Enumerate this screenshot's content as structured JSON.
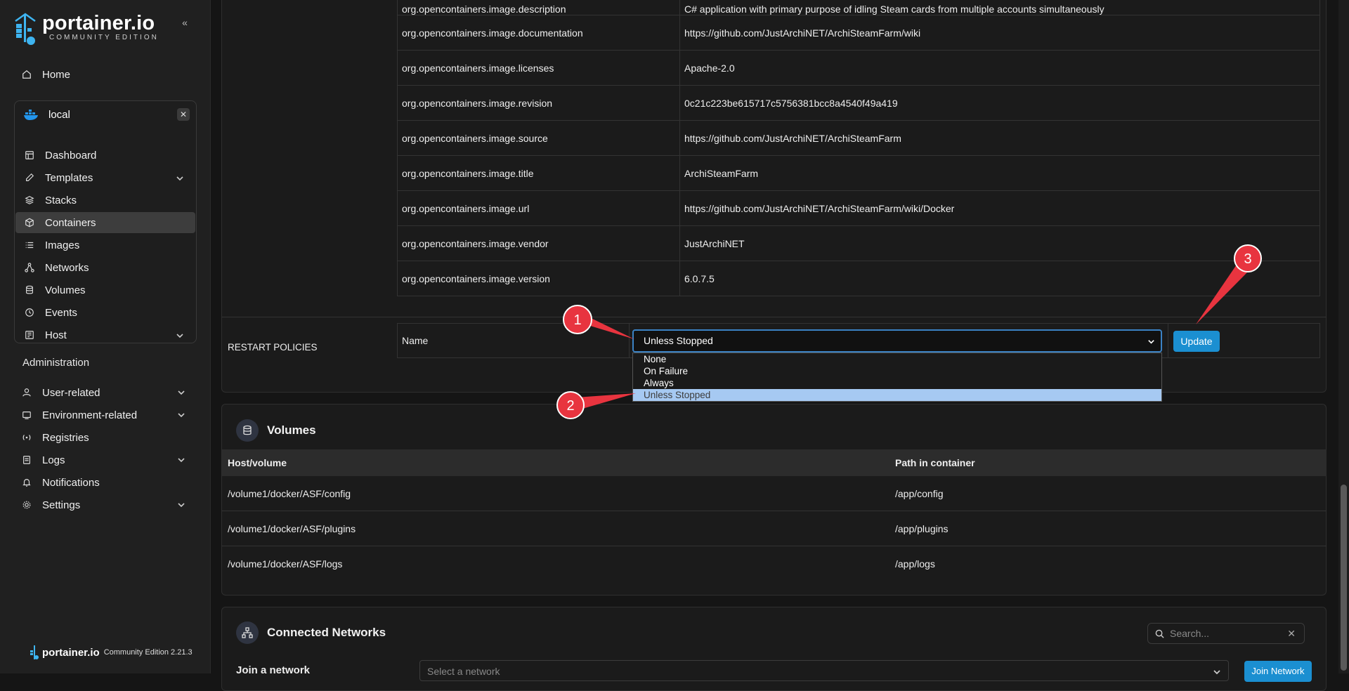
{
  "sidebar": {
    "logo_main": "portainer.io",
    "logo_sub": "COMMUNITY EDITION",
    "home": "Home",
    "environment": {
      "name": "local",
      "close": "✕",
      "items": [
        {
          "label": "Dashboard",
          "icon": "dashboard-icon"
        },
        {
          "label": "Templates",
          "icon": "edit-icon"
        },
        {
          "label": "Stacks",
          "icon": "layers-icon"
        },
        {
          "label": "Containers",
          "icon": "box-icon"
        },
        {
          "label": "Images",
          "icon": "list-icon"
        },
        {
          "label": "Networks",
          "icon": "network-icon"
        },
        {
          "label": "Volumes",
          "icon": "database-icon"
        },
        {
          "label": "Events",
          "icon": "clock-icon"
        },
        {
          "label": "Host",
          "icon": "server-icon"
        }
      ],
      "active": "Containers"
    },
    "admin_title": "Administration",
    "admin_items": [
      {
        "label": "User-related"
      },
      {
        "label": "Environment-related"
      },
      {
        "label": "Registries"
      },
      {
        "label": "Logs"
      },
      {
        "label": "Notifications"
      },
      {
        "label": "Settings"
      }
    ],
    "footer_brand": "portainer.io",
    "footer_version": "Community Edition 2.21.3"
  },
  "labels": [
    {
      "key": "org.opencontainers.image.description",
      "value": "C# application with primary purpose of idling Steam cards from multiple accounts simultaneously"
    },
    {
      "key": "org.opencontainers.image.documentation",
      "value": "https://github.com/JustArchiNET/ArchiSteamFarm/wiki"
    },
    {
      "key": "org.opencontainers.image.licenses",
      "value": "Apache-2.0"
    },
    {
      "key": "org.opencontainers.image.revision",
      "value": "0c21c223be615717c5756381bcc8a4540f49a419"
    },
    {
      "key": "org.opencontainers.image.source",
      "value": "https://github.com/JustArchiNET/ArchiSteamFarm"
    },
    {
      "key": "org.opencontainers.image.title",
      "value": "ArchiSteamFarm"
    },
    {
      "key": "org.opencontainers.image.url",
      "value": "https://github.com/JustArchiNET/ArchiSteamFarm/wiki/Docker"
    },
    {
      "key": "org.opencontainers.image.vendor",
      "value": "JustArchiNET"
    },
    {
      "key": "org.opencontainers.image.version",
      "value": "6.0.7.5"
    }
  ],
  "restart_policies": {
    "section_label": "RESTART POLICIES",
    "name_label": "Name",
    "selected": "Unless Stopped",
    "options": [
      "None",
      "On Failure",
      "Always",
      "Unless Stopped"
    ],
    "update_button": "Update"
  },
  "volumes": {
    "title": "Volumes",
    "col_host": "Host/volume",
    "col_path": "Path in container",
    "rows": [
      {
        "host": "/volume1/docker/ASF/config",
        "path": "/app/config"
      },
      {
        "host": "/volume1/docker/ASF/plugins",
        "path": "/app/plugins"
      },
      {
        "host": "/volume1/docker/ASF/logs",
        "path": "/app/logs"
      }
    ]
  },
  "networks": {
    "title": "Connected Networks",
    "search_placeholder": "Search...",
    "join_label": "Join a network",
    "select_placeholder": "Select a network",
    "join_button": "Join Network"
  },
  "annotations": [
    "1",
    "2",
    "3"
  ],
  "colors": {
    "accent": "#1b8fd1",
    "callout": "#e8343f",
    "active_bg": "#3d3d3d"
  }
}
